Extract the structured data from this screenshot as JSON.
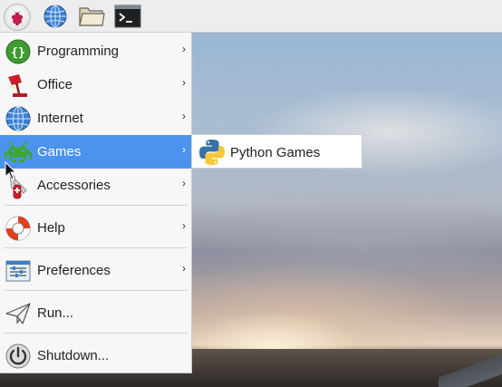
{
  "taskbar": {
    "buttons": [
      {
        "icon": "raspberry-menu-icon"
      },
      {
        "icon": "web-browser-globe-icon"
      },
      {
        "icon": "file-manager-folder-icon"
      },
      {
        "icon": "terminal-icon",
        "text": ">_"
      }
    ]
  },
  "menu": {
    "items": [
      {
        "label": "Programming",
        "icon": "programming-icon",
        "has_submenu": true
      },
      {
        "label": "Office",
        "icon": "office-lamp-icon",
        "has_submenu": true
      },
      {
        "label": "Internet",
        "icon": "internet-globe-icon",
        "has_submenu": true
      },
      {
        "label": "Games",
        "icon": "games-invader-icon",
        "has_submenu": true,
        "active": true
      },
      {
        "label": "Accessories",
        "icon": "accessories-knife-icon",
        "has_submenu": true
      },
      {
        "label": "Help",
        "icon": "help-lifebuoy-icon",
        "has_submenu": true
      },
      {
        "label": "Preferences",
        "icon": "preferences-icon",
        "has_submenu": true
      },
      {
        "label": "Run...",
        "icon": "run-paper-plane-icon",
        "has_submenu": false
      },
      {
        "label": "Shutdown...",
        "icon": "shutdown-power-icon",
        "has_submenu": false
      }
    ],
    "arrow_glyph": "›"
  },
  "submenu": {
    "items": [
      {
        "label": "Python Games",
        "icon": "python-icon"
      }
    ]
  },
  "colors": {
    "accent": "#4c93ee",
    "menu_bg": "#f7f7f7",
    "taskbar_bg": "#ededed"
  }
}
